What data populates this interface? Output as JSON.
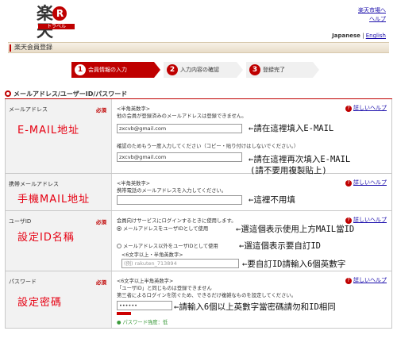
{
  "header": {
    "logo_kanji_1": "楽",
    "logo_circle": "R",
    "logo_kanji_2": "天",
    "logo_sub": "トラベル",
    "link_market": "楽天市場へ",
    "link_help": "ヘルプ",
    "lang_current": "Japanese",
    "lang_sep": "|",
    "lang_other": "English"
  },
  "page_title": "楽天会員登録",
  "steps": [
    {
      "num": "1",
      "label": "会員情報の入力"
    },
    {
      "num": "2",
      "label": "入力内容の確認"
    },
    {
      "num": "3",
      "label": "登録完了"
    }
  ],
  "section_title": "メールアドレス/ユーザーID/パスワード",
  "help_label": "詳しいヘルプ",
  "required_label": "必須",
  "email": {
    "label": "メールアドレス",
    "annotation": "E-MAIL地址",
    "note": "<半角英数字>",
    "note2": "他の会員が登録済みのメールアドレスは登録できません。",
    "value": "zxcvb@gmail.com",
    "confirm_note": "確認のためもう一度入力してください（コピー・貼り付けはしないでください。）",
    "confirm_value": "zxcvb@gmail.com",
    "arrow1": "←請在這裡填入E-MAIL",
    "arrow2": "←請在這裡再次填入E-MAIL",
    "arrow2b": "(請不要用複製貼上)"
  },
  "mobile": {
    "label": "携帯メールアドレス",
    "annotation": "手機MAIL地址",
    "note": "<半角英数字>",
    "note2": "携帯電話のメールアドレスを入力してください。",
    "value": "",
    "arrow": "←這裡不用填"
  },
  "userid": {
    "label": "ユーザID",
    "annotation": "設定ID名稱",
    "note": "会員向けサービスにログインするときに使用します。",
    "radio1": "メールアドレスをユーザIDとして使用",
    "radio2": "メールアドレス以外をユーザIDとして使用",
    "note3": "<6文字以上・半角英数字>",
    "placeholder": "(例) rakuten_713894",
    "arrow1": "←選這個表示使用上方MAIL當ID",
    "arrow2": "←選這個表示要自訂ID",
    "arrow3": "←要自訂ID請輸入6個英數字"
  },
  "password": {
    "label": "パスワード",
    "annotation": "設定密碼",
    "note": "<6文字以上半角英数字>",
    "note2": "「ユーザID」と同じものは登録できません",
    "note3": "第三者によるログインを防ぐため、できるだけ複雑なものを設定してください。",
    "value": "••••••",
    "strength": "パスワード強度：低",
    "arrow": "←請輸入6個以上英數字當密碼請勿和ID相同"
  }
}
